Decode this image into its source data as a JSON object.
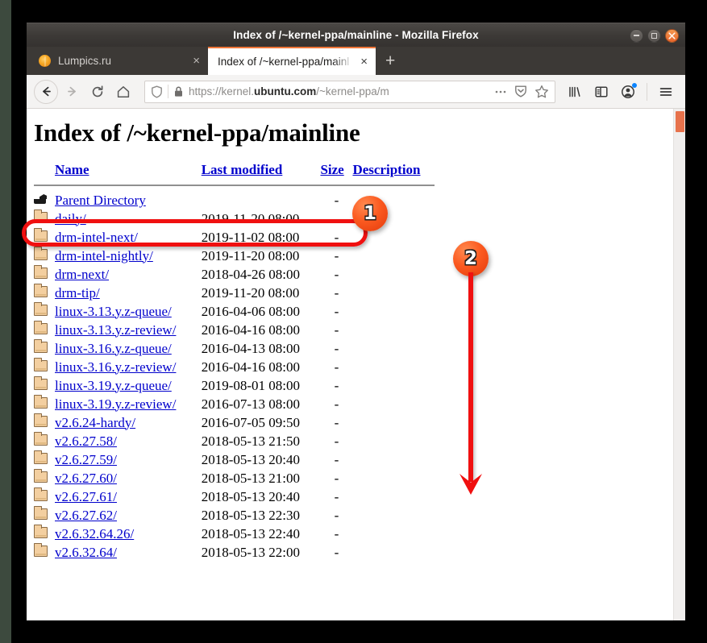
{
  "window": {
    "title": "Index of /~kernel-ppa/mainline - Mozilla Firefox",
    "controls": {
      "minimize": "minimize",
      "maximize": "maximize",
      "close": "close"
    }
  },
  "tabs": [
    {
      "title": "Lumpics.ru",
      "favicon": "orange-circle-favicon",
      "close_label": "×",
      "active": false
    },
    {
      "title": "Index of /~kernel-ppa/mainl",
      "close_label": "×",
      "active": true
    }
  ],
  "newtab_label": "+",
  "toolbar": {
    "back_icon": "back-arrow-icon",
    "forward_icon": "forward-arrow-icon",
    "reload_icon": "reload-icon",
    "home_icon": "home-icon",
    "library_icon": "library-icon",
    "sidebar_icon": "sidebar-icon",
    "account_icon": "account-icon",
    "menu_icon": "hamburger-menu-icon"
  },
  "urlbar": {
    "shield_icon": "tracking-protection-shield-icon",
    "lock_icon": "padlock-icon",
    "url_prefix": "https://kernel.",
    "url_domain": "ubuntu.com",
    "url_suffix": "/~kernel-ppa/m",
    "page_actions_icon": "ellipsis-icon",
    "pocket_icon": "pocket-save-icon",
    "bookmark_icon": "star-bookmark-icon"
  },
  "page": {
    "title": "Index of /~kernel-ppa/mainline",
    "columns": {
      "name": "Name",
      "last_modified": "Last modified",
      "size": "Size",
      "description": "Description"
    },
    "parent": {
      "name": "Parent Directory",
      "date": "",
      "size": "-",
      "desc": "",
      "icon": "parent-directory-icon"
    },
    "rows": [
      {
        "name": "daily/",
        "date": "2019-11-20 08:00",
        "size": "-",
        "desc": ""
      },
      {
        "name": "drm-intel-next/",
        "date": "2019-11-02 08:00",
        "size": "-",
        "desc": ""
      },
      {
        "name": "drm-intel-nightly/",
        "date": "2019-11-20 08:00",
        "size": "-",
        "desc": ""
      },
      {
        "name": "drm-next/",
        "date": "2018-04-26 08:00",
        "size": "-",
        "desc": ""
      },
      {
        "name": "drm-tip/",
        "date": "2019-11-20 08:00",
        "size": "-",
        "desc": ""
      },
      {
        "name": "linux-3.13.y.z-queue/",
        "date": "2016-04-06 08:00",
        "size": "-",
        "desc": ""
      },
      {
        "name": "linux-3.13.y.z-review/",
        "date": "2016-04-16 08:00",
        "size": "-",
        "desc": ""
      },
      {
        "name": "linux-3.16.y.z-queue/",
        "date": "2016-04-13 08:00",
        "size": "-",
        "desc": ""
      },
      {
        "name": "linux-3.16.y.z-review/",
        "date": "2016-04-16 08:00",
        "size": "-",
        "desc": ""
      },
      {
        "name": "linux-3.19.y.z-queue/",
        "date": "2019-08-01 08:00",
        "size": "-",
        "desc": ""
      },
      {
        "name": "linux-3.19.y.z-review/",
        "date": "2016-07-13 08:00",
        "size": "-",
        "desc": ""
      },
      {
        "name": "v2.6.24-hardy/",
        "date": "2016-07-05 09:50",
        "size": "-",
        "desc": ""
      },
      {
        "name": "v2.6.27.58/",
        "date": "2018-05-13 21:50",
        "size": "-",
        "desc": ""
      },
      {
        "name": "v2.6.27.59/",
        "date": "2018-05-13 20:40",
        "size": "-",
        "desc": ""
      },
      {
        "name": "v2.6.27.60/",
        "date": "2018-05-13 21:00",
        "size": "-",
        "desc": ""
      },
      {
        "name": "v2.6.27.61/",
        "date": "2018-05-13 20:40",
        "size": "-",
        "desc": ""
      },
      {
        "name": "v2.6.27.62/",
        "date": "2018-05-13 22:30",
        "size": "-",
        "desc": ""
      },
      {
        "name": "v2.6.32.64.26/",
        "date": "2018-05-13 22:40",
        "size": "-",
        "desc": ""
      },
      {
        "name": "v2.6.32.64/",
        "date": "2018-05-13 22:00",
        "size": "-",
        "desc": ""
      }
    ]
  },
  "annotations": {
    "badge_1": "1",
    "badge_2": "2",
    "highlight_color": "#f01010",
    "badge_color": "#fb5a20",
    "arrow": "down-arrow"
  },
  "scrollbar": {
    "thumb_color": "#e7724c"
  }
}
